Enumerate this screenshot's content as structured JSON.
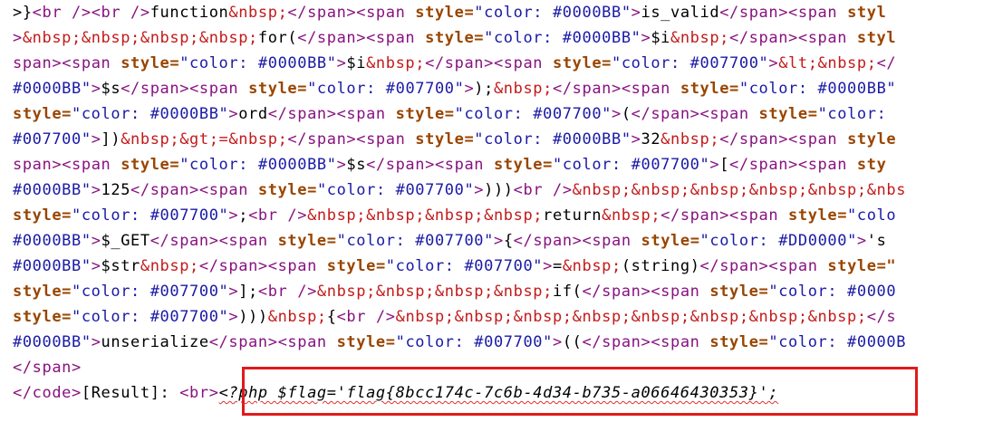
{
  "source_view": {
    "lines": [
      [
        {
          "k": "t",
          "v": ">}"
        },
        {
          "k": "g",
          "v": "<br />"
        },
        {
          "k": "g",
          "v": "<br />"
        },
        {
          "k": "t",
          "v": "function"
        },
        {
          "k": "e",
          "v": "&nbsp;"
        },
        {
          "k": "g",
          "v": "</span>"
        },
        {
          "k": "g",
          "v": "<span "
        },
        {
          "k": "a",
          "v": "style="
        },
        {
          "k": "s",
          "v": "\"color: #0000BB\""
        },
        {
          "k": "g",
          "v": ">"
        },
        {
          "k": "t",
          "v": "is_valid"
        },
        {
          "k": "g",
          "v": "</span>"
        },
        {
          "k": "g",
          "v": "<span "
        },
        {
          "k": "a",
          "v": "styl"
        }
      ],
      [
        {
          "k": "g",
          "v": ">"
        },
        {
          "k": "e",
          "v": "&nbsp;&nbsp;&nbsp;&nbsp;"
        },
        {
          "k": "t",
          "v": "for("
        },
        {
          "k": "g",
          "v": "</span>"
        },
        {
          "k": "g",
          "v": "<span "
        },
        {
          "k": "a",
          "v": "style="
        },
        {
          "k": "s",
          "v": "\"color: #0000BB\""
        },
        {
          "k": "g",
          "v": ">"
        },
        {
          "k": "t",
          "v": "$i"
        },
        {
          "k": "e",
          "v": "&nbsp;"
        },
        {
          "k": "g",
          "v": "</span>"
        },
        {
          "k": "g",
          "v": "<span "
        },
        {
          "k": "a",
          "v": "styl"
        }
      ],
      [
        {
          "k": "g",
          "v": "span>"
        },
        {
          "k": "g",
          "v": "<span "
        },
        {
          "k": "a",
          "v": "style="
        },
        {
          "k": "s",
          "v": "\"color: #0000BB\""
        },
        {
          "k": "g",
          "v": ">"
        },
        {
          "k": "t",
          "v": "$i"
        },
        {
          "k": "e",
          "v": "&nbsp;"
        },
        {
          "k": "g",
          "v": "</span>"
        },
        {
          "k": "g",
          "v": "<span "
        },
        {
          "k": "a",
          "v": "style="
        },
        {
          "k": "s",
          "v": "\"color: #007700\""
        },
        {
          "k": "g",
          "v": ">"
        },
        {
          "k": "e",
          "v": "&lt;&nbsp;"
        },
        {
          "k": "g",
          "v": "</"
        }
      ],
      [
        {
          "k": "s",
          "v": "#0000BB\""
        },
        {
          "k": "g",
          "v": ">"
        },
        {
          "k": "t",
          "v": "$s"
        },
        {
          "k": "g",
          "v": "</span>"
        },
        {
          "k": "g",
          "v": "<span "
        },
        {
          "k": "a",
          "v": "style="
        },
        {
          "k": "s",
          "v": "\"color: #007700\""
        },
        {
          "k": "g",
          "v": ">"
        },
        {
          "k": "t",
          "v": ");"
        },
        {
          "k": "e",
          "v": "&nbsp;"
        },
        {
          "k": "g",
          "v": "</span>"
        },
        {
          "k": "g",
          "v": "<span "
        },
        {
          "k": "a",
          "v": "style="
        },
        {
          "k": "s",
          "v": "\"color: #0000BB\""
        }
      ],
      [
        {
          "k": "a",
          "v": "style="
        },
        {
          "k": "s",
          "v": "\"color: #0000BB\""
        },
        {
          "k": "g",
          "v": ">"
        },
        {
          "k": "t",
          "v": "ord"
        },
        {
          "k": "g",
          "v": "</span>"
        },
        {
          "k": "g",
          "v": "<span "
        },
        {
          "k": "a",
          "v": "style="
        },
        {
          "k": "s",
          "v": "\"color: #007700\""
        },
        {
          "k": "g",
          "v": ">"
        },
        {
          "k": "t",
          "v": "("
        },
        {
          "k": "g",
          "v": "</span>"
        },
        {
          "k": "g",
          "v": "<span "
        },
        {
          "k": "a",
          "v": "style="
        },
        {
          "k": "s",
          "v": "\"color:"
        }
      ],
      [
        {
          "k": "s",
          "v": "#007700\""
        },
        {
          "k": "g",
          "v": ">"
        },
        {
          "k": "t",
          "v": "])"
        },
        {
          "k": "e",
          "v": "&nbsp;&gt;="
        },
        {
          "k": "e",
          "v": "&nbsp;"
        },
        {
          "k": "g",
          "v": "</span>"
        },
        {
          "k": "g",
          "v": "<span "
        },
        {
          "k": "a",
          "v": "style="
        },
        {
          "k": "s",
          "v": "\"color: #0000BB\""
        },
        {
          "k": "g",
          "v": ">"
        },
        {
          "k": "t",
          "v": "32"
        },
        {
          "k": "e",
          "v": "&nbsp;"
        },
        {
          "k": "g",
          "v": "</span>"
        },
        {
          "k": "g",
          "v": "<span "
        },
        {
          "k": "a",
          "v": "style"
        }
      ],
      [
        {
          "k": "g",
          "v": "span>"
        },
        {
          "k": "g",
          "v": "<span "
        },
        {
          "k": "a",
          "v": "style="
        },
        {
          "k": "s",
          "v": "\"color: #0000BB\""
        },
        {
          "k": "g",
          "v": ">"
        },
        {
          "k": "t",
          "v": "$s"
        },
        {
          "k": "g",
          "v": "</span>"
        },
        {
          "k": "g",
          "v": "<span "
        },
        {
          "k": "a",
          "v": "style="
        },
        {
          "k": "s",
          "v": "\"color: #007700\""
        },
        {
          "k": "g",
          "v": ">"
        },
        {
          "k": "t",
          "v": "["
        },
        {
          "k": "g",
          "v": "</span>"
        },
        {
          "k": "g",
          "v": "<span "
        },
        {
          "k": "a",
          "v": "sty"
        }
      ],
      [
        {
          "k": "s",
          "v": "#0000BB\""
        },
        {
          "k": "g",
          "v": ">"
        },
        {
          "k": "t",
          "v": "125"
        },
        {
          "k": "g",
          "v": "</span>"
        },
        {
          "k": "g",
          "v": "<span "
        },
        {
          "k": "a",
          "v": "style="
        },
        {
          "k": "s",
          "v": "\"color: #007700\""
        },
        {
          "k": "g",
          "v": ">"
        },
        {
          "k": "t",
          "v": ")))"
        },
        {
          "k": "g",
          "v": "<br />"
        },
        {
          "k": "e",
          "v": "&nbsp;&nbsp;&nbsp;&nbsp;&nbsp;&nbs"
        }
      ],
      [
        {
          "k": "a",
          "v": "style="
        },
        {
          "k": "s",
          "v": "\"color: #007700\""
        },
        {
          "k": "g",
          "v": ">"
        },
        {
          "k": "t",
          "v": ";"
        },
        {
          "k": "g",
          "v": "<br />"
        },
        {
          "k": "e",
          "v": "&nbsp;&nbsp;&nbsp;&nbsp;"
        },
        {
          "k": "t",
          "v": "return"
        },
        {
          "k": "e",
          "v": "&nbsp;"
        },
        {
          "k": "g",
          "v": "</span>"
        },
        {
          "k": "g",
          "v": "<span "
        },
        {
          "k": "a",
          "v": "style="
        },
        {
          "k": "s",
          "v": "\"colo"
        }
      ],
      [
        {
          "k": "s",
          "v": "#0000BB\""
        },
        {
          "k": "g",
          "v": ">"
        },
        {
          "k": "t",
          "v": "$_GET"
        },
        {
          "k": "g",
          "v": "</span>"
        },
        {
          "k": "g",
          "v": "<span "
        },
        {
          "k": "a",
          "v": "style="
        },
        {
          "k": "s",
          "v": "\"color: #007700\""
        },
        {
          "k": "g",
          "v": ">"
        },
        {
          "k": "t",
          "v": "{"
        },
        {
          "k": "g",
          "v": "</span>"
        },
        {
          "k": "g",
          "v": "<span "
        },
        {
          "k": "a",
          "v": "style="
        },
        {
          "k": "s",
          "v": "\"color: #DD0000\""
        },
        {
          "k": "g",
          "v": ">"
        },
        {
          "k": "t",
          "v": "'s"
        }
      ],
      [
        {
          "k": "s",
          "v": "#0000BB\""
        },
        {
          "k": "g",
          "v": ">"
        },
        {
          "k": "t",
          "v": "$str"
        },
        {
          "k": "e",
          "v": "&nbsp;"
        },
        {
          "k": "g",
          "v": "</span>"
        },
        {
          "k": "g",
          "v": "<span "
        },
        {
          "k": "a",
          "v": "style="
        },
        {
          "k": "s",
          "v": "\"color: #007700\""
        },
        {
          "k": "g",
          "v": ">"
        },
        {
          "k": "t",
          "v": "="
        },
        {
          "k": "e",
          "v": "&nbsp;"
        },
        {
          "k": "t",
          "v": "(string)"
        },
        {
          "k": "g",
          "v": "</span>"
        },
        {
          "k": "g",
          "v": "<span "
        },
        {
          "k": "a",
          "v": "style=\""
        }
      ],
      [
        {
          "k": "a",
          "v": "style="
        },
        {
          "k": "s",
          "v": "\"color: #007700\""
        },
        {
          "k": "g",
          "v": ">"
        },
        {
          "k": "t",
          "v": "];"
        },
        {
          "k": "g",
          "v": "<br />"
        },
        {
          "k": "e",
          "v": "&nbsp;&nbsp;&nbsp;&nbsp;"
        },
        {
          "k": "t",
          "v": "if("
        },
        {
          "k": "g",
          "v": "</span>"
        },
        {
          "k": "g",
          "v": "<span "
        },
        {
          "k": "a",
          "v": "style="
        },
        {
          "k": "s",
          "v": "\"color: #0000"
        }
      ],
      [
        {
          "k": "a",
          "v": "style="
        },
        {
          "k": "s",
          "v": "\"color: #007700\""
        },
        {
          "k": "g",
          "v": ">"
        },
        {
          "k": "t",
          "v": ")))"
        },
        {
          "k": "e",
          "v": "&nbsp;"
        },
        {
          "k": "t",
          "v": "{"
        },
        {
          "k": "g",
          "v": "<br />"
        },
        {
          "k": "e",
          "v": "&nbsp;&nbsp;&nbsp;&nbsp;&nbsp;&nbsp;&nbsp;&nbsp;"
        },
        {
          "k": "g",
          "v": "</s"
        }
      ],
      [
        {
          "k": "s",
          "v": "#0000BB\""
        },
        {
          "k": "g",
          "v": ">"
        },
        {
          "k": "t",
          "v": "unserialize"
        },
        {
          "k": "g",
          "v": "</span>"
        },
        {
          "k": "g",
          "v": "<span "
        },
        {
          "k": "a",
          "v": "style="
        },
        {
          "k": "s",
          "v": "\"color: #007700\""
        },
        {
          "k": "g",
          "v": ">"
        },
        {
          "k": "t",
          "v": "(("
        },
        {
          "k": "g",
          "v": "</span>"
        },
        {
          "k": "g",
          "v": "<span "
        },
        {
          "k": "a",
          "v": "style="
        },
        {
          "k": "s",
          "v": "\"color: #0000B"
        }
      ],
      [
        {
          "k": "g",
          "v": "</span>"
        }
      ],
      [
        {
          "k": "g",
          "v": "</code>"
        },
        {
          "k": "t",
          "v": "[Result]: "
        },
        {
          "k": "g",
          "v": "<br>"
        },
        {
          "k": "p",
          "v": "<?php $flag='flag{8bcc174c-7c6b-4d34-b735-a06646430353}';"
        }
      ]
    ]
  },
  "highlight": {
    "color": "#e01b1b",
    "label": "flag-result-highlight"
  }
}
